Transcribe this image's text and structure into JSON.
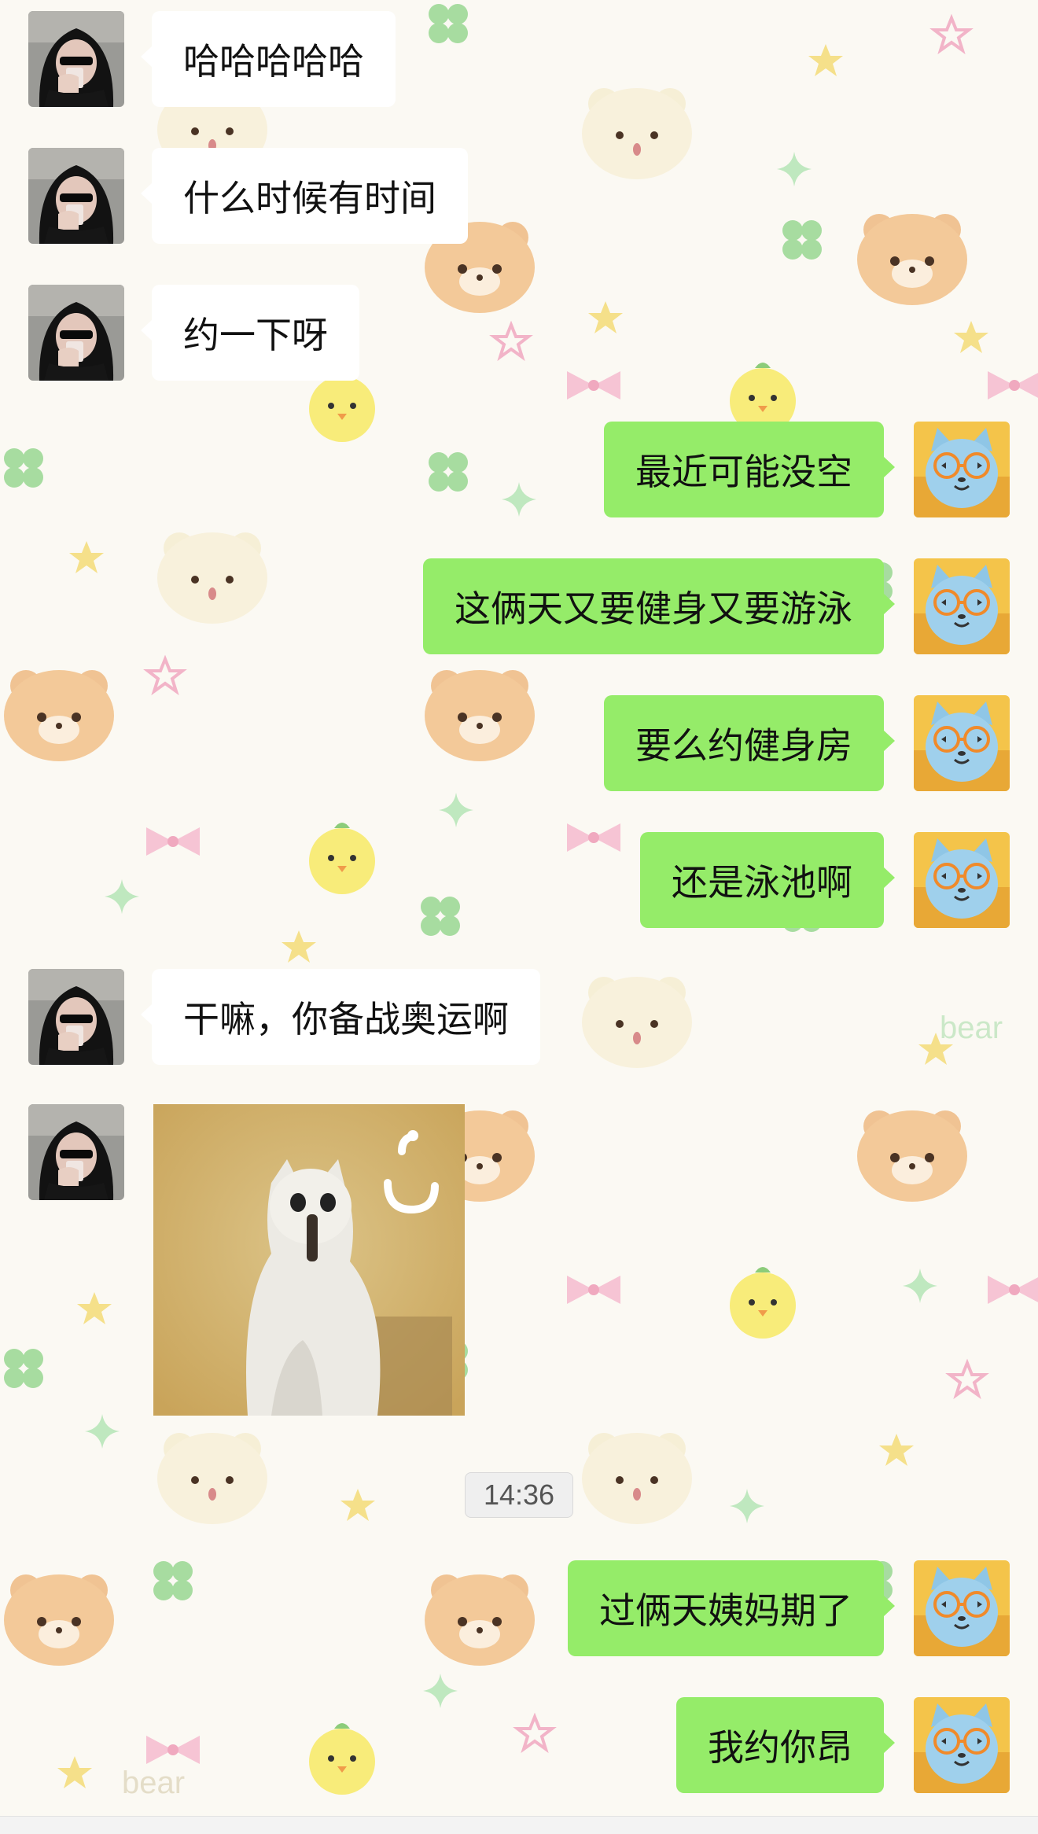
{
  "messages": [
    {
      "side": "left",
      "text": "哈哈哈哈哈"
    },
    {
      "side": "left",
      "text": "什么时候有时间"
    },
    {
      "side": "left",
      "text": "约一下呀"
    },
    {
      "side": "right",
      "text": "最近可能没空"
    },
    {
      "side": "right",
      "text": "这俩天又要健身又要游泳"
    },
    {
      "side": "right",
      "text": "要么约健身房"
    },
    {
      "side": "right",
      "text": "还是泳池啊"
    },
    {
      "side": "left",
      "text": "干嘛，你备战奥运啊"
    },
    {
      "side": "left",
      "sticker": "confused-dog-sticker"
    },
    {
      "side": "right",
      "text": "过俩天姨妈期了"
    },
    {
      "side": "right",
      "text": "我约你昂"
    }
  ],
  "timestamp": "14:36",
  "wallpaper_watermark": "bear",
  "colors": {
    "sent_bubble": "#95ec69",
    "received_bubble": "#ffffff",
    "wallpaper": "#fbf9f3"
  },
  "icons": {
    "left_avatar": "hooded-person-avatar",
    "right_avatar": "blue-cat-glasses-avatar"
  }
}
